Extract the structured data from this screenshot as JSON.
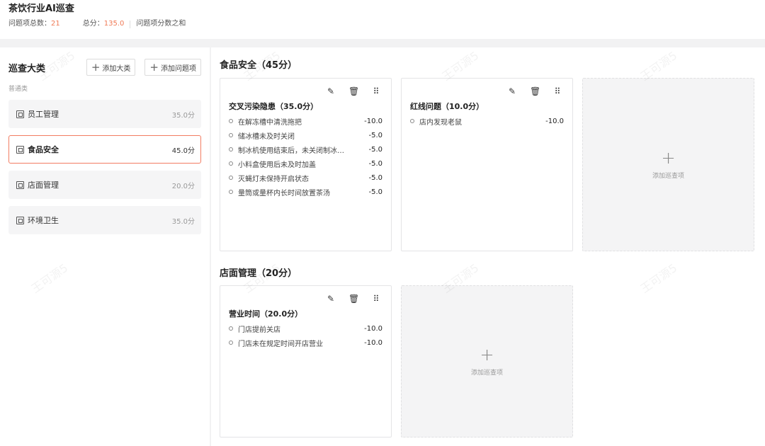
{
  "header": {
    "title": "茶饮行业AI巡查",
    "issue_count_label": "问题项总数：",
    "issue_count": "21",
    "total_label": "总分：",
    "total": "135.0",
    "total_note": "问题项分数之和"
  },
  "sidebar": {
    "title": "巡查大类",
    "add_category": "添加大类",
    "add_issue": "添加问题项",
    "group_label": "普通类",
    "categories": [
      {
        "name": "员工管理",
        "score": "35.0分"
      },
      {
        "name": "食品安全",
        "score": "45.0分"
      },
      {
        "name": "店面管理",
        "score": "20.0分"
      },
      {
        "name": "环境卫生",
        "score": "35.0分"
      }
    ]
  },
  "main": {
    "sections": [
      {
        "title": "食品安全（45分）",
        "cards": [
          {
            "title": "交叉污染隐患（35.0分）",
            "items": [
              {
                "text": "在解冻槽中清洗拖把",
                "value": "-10.0"
              },
              {
                "text": "储冰槽未及时关闭",
                "value": "-5.0"
              },
              {
                "text": "制冰机使用结束后，未关闭制冰…",
                "value": "-5.0"
              },
              {
                "text": "小料盒使用后未及时加盖",
                "value": "-5.0"
              },
              {
                "text": "灭蝇灯未保持开启状态",
                "value": "-5.0"
              },
              {
                "text": "量筒或量杯内长时间放置茶汤",
                "value": "-5.0"
              }
            ]
          },
          {
            "title": "红线问题（10.0分）",
            "items": [
              {
                "text": "店内发现老鼠",
                "value": "-10.0"
              }
            ]
          }
        ],
        "add_label": "添加巡查项"
      },
      {
        "title": "店面管理（20分）",
        "cards": [
          {
            "title": "营业时间（20.0分）",
            "items": [
              {
                "text": "门店提前关店",
                "value": "-10.0"
              },
              {
                "text": "门店未在规定时间开店营业",
                "value": "-10.0"
              }
            ]
          }
        ],
        "add_label": "添加巡查项"
      }
    ]
  },
  "icons": {
    "edit": "pencil-icon",
    "delete": "trash-icon",
    "drag": "drag-handle-icon",
    "category": "category-icon",
    "add": "plus-icon"
  },
  "colors": {
    "accent": "#f27c62",
    "number": "#f07a55"
  },
  "watermark": "王可源5"
}
